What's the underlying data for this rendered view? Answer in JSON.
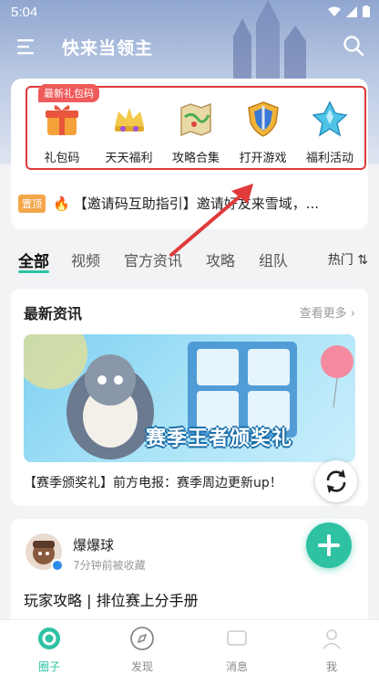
{
  "status": {
    "time": "5:04"
  },
  "app": {
    "title": "快来当领主"
  },
  "shortcuts": {
    "badge": "最新礼包码",
    "items": [
      {
        "label": "礼包码",
        "icon": "gift-icon"
      },
      {
        "label": "天天福利",
        "icon": "crown-gems-icon"
      },
      {
        "label": "攻略合集",
        "icon": "map-icon"
      },
      {
        "label": "打开游戏",
        "icon": "shield-sword-icon"
      },
      {
        "label": "福利活动",
        "icon": "crystal-icon"
      }
    ]
  },
  "notice": {
    "tag": "置顶",
    "text": "【邀请码互助指引】邀请好友来雪域，..."
  },
  "tabs": {
    "items": [
      "全部",
      "视频",
      "官方资讯",
      "攻略",
      "组队"
    ],
    "hot": "热门"
  },
  "news": {
    "heading": "最新资讯",
    "more": "查看更多",
    "banner_text": "赛季王者颁奖礼",
    "caption": "【赛季颁奖礼】前方电报：赛季周边更新up！"
  },
  "post": {
    "author": "爆爆球",
    "meta": "7分钟前被收藏",
    "title": "玩家攻略 | 排位赛上分手册"
  },
  "nav": {
    "items": [
      {
        "label": "圈子",
        "icon": "circle-icon"
      },
      {
        "label": "发现",
        "icon": "compass-icon"
      },
      {
        "label": "消息",
        "icon": "message-icon"
      },
      {
        "label": "我",
        "icon": "person-icon"
      }
    ]
  },
  "colors": {
    "accent": "#2ec2a3",
    "highlight_box": "#e03a3a",
    "badge": "#ef5a5a"
  }
}
